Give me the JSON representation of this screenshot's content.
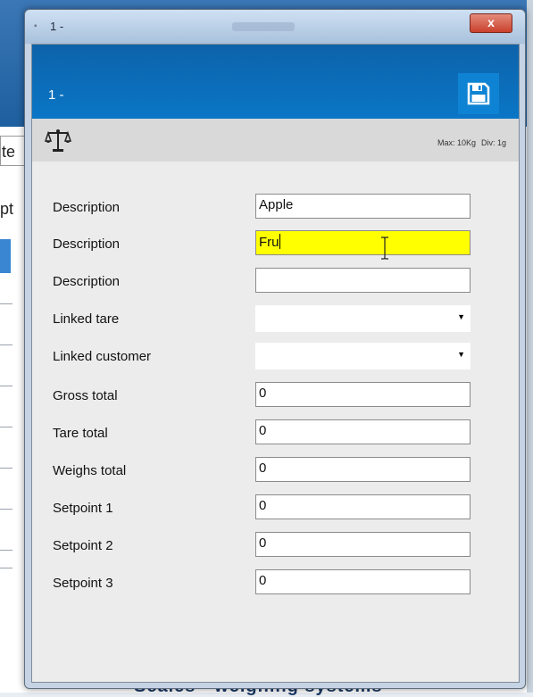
{
  "window": {
    "title": "1 -",
    "close_glyph": "x"
  },
  "header": {
    "title": "1 -",
    "save_icon": "floppy-disk-icon"
  },
  "scale": {
    "icon": "balance-scale-icon",
    "max": "Max: 10Kg",
    "div": "Div: 1g"
  },
  "form": {
    "rows": [
      {
        "label": "Description",
        "type": "text",
        "value": "Apple"
      },
      {
        "label": "Description",
        "type": "text",
        "value": "Fru",
        "highlighted": true
      },
      {
        "label": "Description",
        "type": "text",
        "value": ""
      },
      {
        "label": "Linked tare",
        "type": "select",
        "value": ""
      },
      {
        "label": "Linked customer",
        "type": "select",
        "value": ""
      },
      {
        "label": "Gross total",
        "type": "text",
        "value": "0"
      },
      {
        "label": "Tare total",
        "type": "text",
        "value": "0"
      },
      {
        "label": "Weighs total",
        "type": "text",
        "value": "0"
      },
      {
        "label": "Setpoint 1",
        "type": "text",
        "value": "0"
      },
      {
        "label": "Setpoint 2",
        "type": "text",
        "value": "0"
      },
      {
        "label": "Setpoint 3",
        "type": "text",
        "value": "0"
      }
    ]
  },
  "background": {
    "left_text_1": "te",
    "left_text_2": "pt",
    "bottom_text": "Scales - weighing systems"
  },
  "colors": {
    "header_blue": "#0a6fbd",
    "highlight_yellow": "#ffff00"
  }
}
